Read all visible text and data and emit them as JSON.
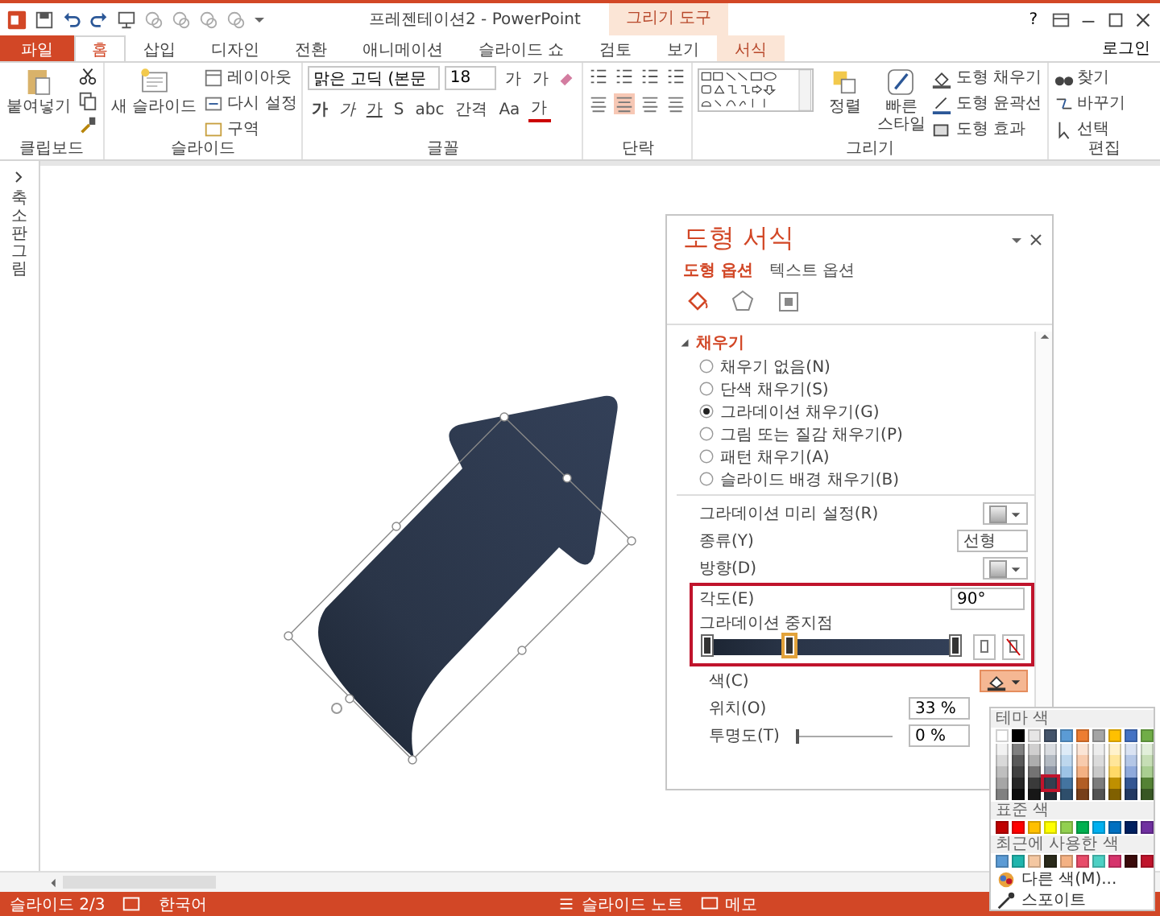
{
  "title_bar": {
    "title": "프레젠테이션2 - PowerPoint",
    "context_title": "그리기 도구",
    "help": "?"
  },
  "tabs": [
    {
      "label": "파일",
      "kind": "file",
      "selected": false
    },
    {
      "label": "홈",
      "kind": "tab",
      "selected": true
    },
    {
      "label": "삽입",
      "kind": "tab",
      "selected": false
    },
    {
      "label": "디자인",
      "kind": "tab",
      "selected": false
    },
    {
      "label": "전환",
      "kind": "tab",
      "selected": false
    },
    {
      "label": "애니메이션",
      "kind": "tab",
      "selected": false
    },
    {
      "label": "슬라이드 쇼",
      "kind": "tab",
      "selected": false
    },
    {
      "label": "검토",
      "kind": "tab",
      "selected": false
    },
    {
      "label": "보기",
      "kind": "tab",
      "selected": false
    },
    {
      "label": "서식",
      "kind": "context",
      "selected": false
    }
  ],
  "sign_in": "로그인",
  "ribbon": {
    "clipboard": {
      "paste": "붙여넣기",
      "label": "클립보드"
    },
    "slides": {
      "new_slide": "새 슬라이드",
      "layout": "레이아웃",
      "reset": "다시 설정",
      "section": "구역",
      "label": "슬라이드"
    },
    "font": {
      "family": "맑은 고딕 (본문",
      "size": "18",
      "grow": "가",
      "shrink": "가",
      "format_buttons": [
        "가",
        "가",
        "가",
        "S",
        "abc",
        "간격",
        "Aa",
        "가"
      ],
      "label": "글꼴"
    },
    "paragraph": {
      "label": "단락"
    },
    "drawing": {
      "arrange": "정렬",
      "quick_styles": "빠른 스타일",
      "shape_fill": "도형 채우기",
      "shape_outline": "도형 윤곽선",
      "shape_effects": "도형 효과",
      "label": "그리기"
    },
    "editing": {
      "find": "찾기",
      "replace": "바꾸기",
      "select": "선택",
      "label": "편집"
    }
  },
  "left_panel": {
    "label": "축소판 그림"
  },
  "format_pane": {
    "title": "도형 서식",
    "tabs": [
      {
        "label": "도형 옵션",
        "selected": true
      },
      {
        "label": "텍스트 옵션",
        "selected": false
      }
    ],
    "icon_tabs": [
      {
        "kind": "fill",
        "selected": true
      },
      {
        "kind": "shape",
        "selected": false
      },
      {
        "kind": "size",
        "selected": false
      }
    ],
    "section": {
      "label": "채우기",
      "expanded": true
    },
    "fill_options": [
      {
        "label": "채우기 없음(N)",
        "selected": false
      },
      {
        "label": "단색 채우기(S)",
        "selected": false
      },
      {
        "label": "그라데이션 채우기(G)",
        "selected": true
      },
      {
        "label": "그림 또는 질감 채우기(P)",
        "selected": false
      },
      {
        "label": "패턴 채우기(A)",
        "selected": false
      },
      {
        "label": "슬라이드 배경 채우기(B)",
        "selected": false
      }
    ],
    "preset_label": "그라데이션 미리 설정(R)",
    "type_label": "종류(Y)",
    "type_value": "선형",
    "direction_label": "방향(D)",
    "angle_label": "각도(E)",
    "angle_value": "90°",
    "stops_label": "그라데이션 중지점",
    "stops": [
      {
        "level": 0,
        "selected": false
      },
      {
        "level": 0.33,
        "selected": true
      },
      {
        "level": 1,
        "selected": false
      }
    ],
    "color_label": "색(C)",
    "color_menu_open": true,
    "position_label": "위치(O)",
    "position_value": "33 %",
    "transparency_label": "투명도(T)",
    "transparency": {
      "level": 0
    },
    "transparency_value": "0 %"
  },
  "color_menu": {
    "theme_label": "테마 색",
    "theme_colors": [
      {
        "color": "#ffffff",
        "shades": [
          {
            "selected": false
          },
          {
            "selected": false
          },
          {
            "selected": false
          },
          {
            "selected": false
          },
          {
            "selected": false
          }
        ]
      },
      {
        "color": "#000000",
        "shades": [
          {
            "selected": false
          },
          {
            "selected": false
          },
          {
            "selected": false
          },
          {
            "selected": false
          },
          {
            "selected": false
          }
        ]
      },
      {
        "color": "#e7e6e6",
        "shades": [
          {
            "selected": false
          },
          {
            "selected": false
          },
          {
            "selected": false
          },
          {
            "selected": false
          },
          {
            "selected": false
          }
        ]
      },
      {
        "color": "#44546a",
        "shades": [
          {
            "selected": false
          },
          {
            "selected": false
          },
          {
            "selected": false
          },
          {
            "selected": true
          },
          {
            "selected": false
          }
        ]
      },
      {
        "color": "#5b9bd5",
        "shades": [
          {
            "selected": false
          },
          {
            "selected": false
          },
          {
            "selected": false
          },
          {
            "selected": false
          },
          {
            "selected": false
          }
        ]
      },
      {
        "color": "#ed7d31",
        "shades": [
          {
            "selected": false
          },
          {
            "selected": false
          },
          {
            "selected": false
          },
          {
            "selected": false
          },
          {
            "selected": false
          }
        ]
      },
      {
        "color": "#a5a5a5",
        "shades": [
          {
            "selected": false
          },
          {
            "selected": false
          },
          {
            "selected": false
          },
          {
            "selected": false
          },
          {
            "selected": false
          }
        ]
      },
      {
        "color": "#ffc000",
        "shades": [
          {
            "selected": false
          },
          {
            "selected": false
          },
          {
            "selected": false
          },
          {
            "selected": false
          },
          {
            "selected": false
          }
        ]
      },
      {
        "color": "#4472c4",
        "shades": [
          {
            "selected": false
          },
          {
            "selected": false
          },
          {
            "selected": false
          },
          {
            "selected": false
          },
          {
            "selected": false
          }
        ]
      },
      {
        "color": "#70ad47",
        "shades": [
          {
            "selected": false
          },
          {
            "selected": false
          },
          {
            "selected": false
          },
          {
            "selected": false
          },
          {
            "selected": false
          }
        ]
      }
    ],
    "standard_label": "표준 색",
    "standard_colors": [
      {
        "color": "#c00000"
      },
      {
        "color": "#ff0000"
      },
      {
        "color": "#ffc000"
      },
      {
        "color": "#ffff00"
      },
      {
        "color": "#92d050"
      },
      {
        "color": "#00b050"
      },
      {
        "color": "#00b0f0"
      },
      {
        "color": "#0070c0"
      },
      {
        "color": "#002060"
      },
      {
        "color": "#7030a0"
      }
    ],
    "recent_label": "최근에 사용한 색",
    "recent_colors": [
      {
        "color": "#5b9bd5"
      },
      {
        "color": "#1fb5ad"
      },
      {
        "color": "#f4c7a1"
      },
      {
        "color": "#2a2a1a"
      },
      {
        "color": "#f4b183"
      },
      {
        "color": "#e84c6a"
      },
      {
        "color": "#4dd0c4"
      },
      {
        "color": "#d6336c"
      },
      {
        "color": "#3b0a0a"
      },
      {
        "color": "#c0142c"
      }
    ],
    "more_colors": "다른 색(M)...",
    "eyedropper": "스포이트"
  },
  "status_bar": {
    "slide": "슬라이드 2/3",
    "language": "한국어",
    "notes": "슬라이드 노트",
    "comments": "메모"
  }
}
